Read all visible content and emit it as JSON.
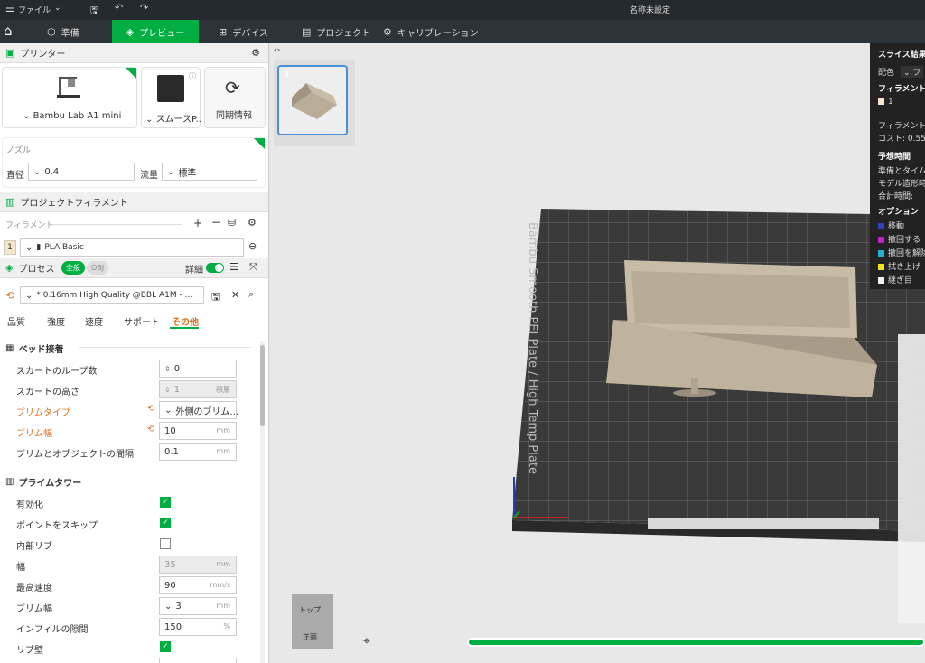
{
  "titlebar": {
    "menu": "ファイル",
    "title": "名称未設定"
  },
  "nav": {
    "tabs": [
      "準備",
      "プレビュー",
      "デバイス",
      "プロジェクト",
      "キャリブレーション"
    ]
  },
  "printer": {
    "header": "プリンター",
    "name": "Bambu Lab A1 mini",
    "plate": "スムースP..",
    "sync": "同期情報"
  },
  "nozzle": {
    "header": "ノズル",
    "diameter_label": "直径",
    "diameter": "0.4",
    "flow_label": "流量",
    "flow": "標準"
  },
  "filament": {
    "header": "プロジェクトフィラメント",
    "sub": "フィラメント",
    "slot": "1",
    "name": "PLA Basic"
  },
  "process": {
    "header": "プロセス",
    "tab_global": "全般",
    "tab_obj": "OBJ",
    "detail": "詳細",
    "preset": "* 0.16mm High Quality @BBL A1M - ..."
  },
  "tabs": [
    "品質",
    "強度",
    "速度",
    "サポート",
    "その他"
  ],
  "bed_adhesion": {
    "title": "ベッド接着",
    "skirt_loops_label": "スカートのループ数",
    "skirt_loops": "0",
    "skirt_height_label": "スカートの高さ",
    "skirt_height": "1",
    "skirt_height_unit": "積層",
    "brim_type_label": "ブリムタイプ",
    "brim_type": "外側のブリム...",
    "brim_width_label": "ブリム幅",
    "brim_width": "10",
    "brim_width_unit": "mm",
    "brim_gap_label": "ブリムとオブジェクトの間隔",
    "brim_gap": "0.1",
    "brim_gap_unit": "mm"
  },
  "prime_tower": {
    "title": "プライムタワー",
    "enable_label": "有効化",
    "skip_label": "ポイントをスキップ",
    "rib_label": "内部リブ",
    "width_label": "幅",
    "width": "35",
    "width_unit": "mm",
    "speed_label": "最高速度",
    "speed": "90",
    "speed_unit": "mm/s",
    "brim_label": "ブリム幅",
    "brim": "3",
    "brim_unit": "mm",
    "infill_gap_label": "インフィルの隙間",
    "infill_gap": "150",
    "infill_gap_unit": "%",
    "rib_wall_label": "リブ壁"
  },
  "plate": {
    "index": "1",
    "label": "Bambu Smooth PEI Plate / High Temp Plate"
  },
  "results": {
    "title": "スライス結果",
    "color_label": "配色",
    "color_val": "フ",
    "filament_h": "フィラメント",
    "f1": "1",
    "filament2": "フィラメント",
    "cost": "コスト: 0.55",
    "time_h": "予想時間",
    "prep": "準備とタイム",
    "model": "モデル造形時",
    "total": "合計時間:",
    "opt_h": "オプション",
    "move": "移動",
    "retract": "撤回する",
    "unretract": "撤回を解除",
    "wipe": "拭き上げ",
    "seam": "継ぎ目"
  },
  "viewcube": {
    "top": "トップ",
    "front": "正面"
  },
  "colors": {
    "accent": "#00ae42",
    "orange": "#e07020"
  }
}
